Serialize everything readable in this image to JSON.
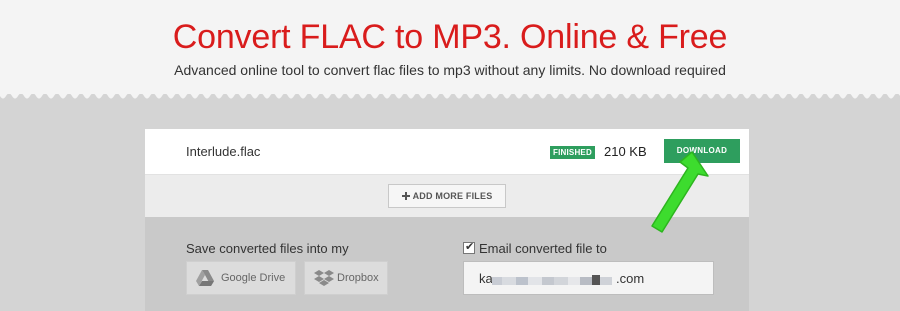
{
  "header": {
    "title": "Convert FLAC to MP3. Online & Free",
    "subtitle": "Advanced online tool to convert flac files to mp3 without any limits. No download required"
  },
  "file": {
    "name": "Interlude.flac",
    "status": "FINISHED",
    "size": "210 KB",
    "download_label": "DOWNLOAD"
  },
  "actions": {
    "add_more_label": "ADD MORE FILES"
  },
  "save": {
    "label": "Save converted files into my",
    "google_drive_label": "Google Drive",
    "dropbox_label": "Dropbox"
  },
  "email": {
    "checked": true,
    "label": "Email converted file to",
    "value_prefix": "ka",
    "value_suffix": ".com"
  },
  "colors": {
    "title_red": "#d91c1c",
    "accent_green": "#2e9e5e",
    "arrow_green": "#3ddc2e"
  },
  "icons": {
    "add": "plus-icon",
    "google_drive": "google-drive-icon",
    "dropbox": "dropbox-icon",
    "checkbox": "checkmark-icon",
    "pointer": "green-arrow-icon"
  }
}
